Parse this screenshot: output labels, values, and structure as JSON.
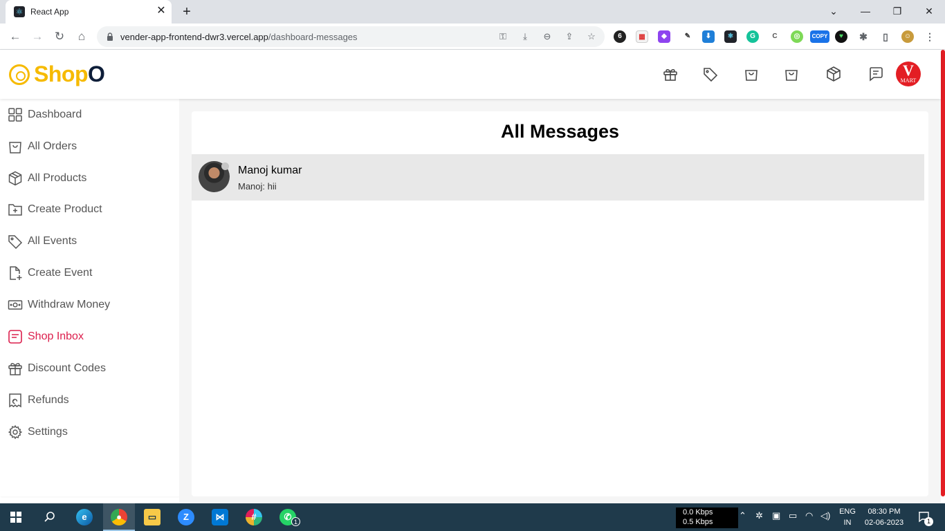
{
  "browser": {
    "tab_title": "React App",
    "url_domain": "vender-app-frontend-dwr3.vercel.app",
    "url_path": "/dashboard-messages",
    "copy_badge": "COPY"
  },
  "header": {
    "logo_main": "Shop",
    "logo_accent": "O",
    "shop_avatar_letter": "V",
    "shop_avatar_subtext": "MART"
  },
  "sidebar": {
    "items": [
      {
        "label": "Dashboard",
        "icon": "grid-icon"
      },
      {
        "label": "All Orders",
        "icon": "shopping-bag-icon"
      },
      {
        "label": "All Products",
        "icon": "package-icon"
      },
      {
        "label": "Create Product",
        "icon": "folder-plus-icon"
      },
      {
        "label": "All Events",
        "icon": "tag-icon"
      },
      {
        "label": "Create Event",
        "icon": "file-plus-icon"
      },
      {
        "label": "Withdraw Money",
        "icon": "money-icon"
      },
      {
        "label": "Shop Inbox",
        "icon": "message-icon",
        "active": true
      },
      {
        "label": "Discount Codes",
        "icon": "gift-icon"
      },
      {
        "label": "Refunds",
        "icon": "receipt-refund-icon"
      },
      {
        "label": "Settings",
        "icon": "gear-icon"
      }
    ]
  },
  "main": {
    "title": "All Messages",
    "conversations": [
      {
        "name": "Manoj kumar",
        "last_message": "Manoj: hii"
      }
    ]
  },
  "taskbar": {
    "net_down": "0.0 Kbps",
    "net_up": "0.5 Kbps",
    "lang_top": "ENG",
    "lang_bottom": "IN",
    "time": "08:30 PM",
    "date": "02-06-2023",
    "whatsapp_badge": "1",
    "notification_badge": "1"
  },
  "colors": {
    "accent": "#dc1e4c",
    "logo_yellow": "#f6ba00",
    "logo_navy": "#0e1e39",
    "shop_avatar": "#e31e24"
  }
}
